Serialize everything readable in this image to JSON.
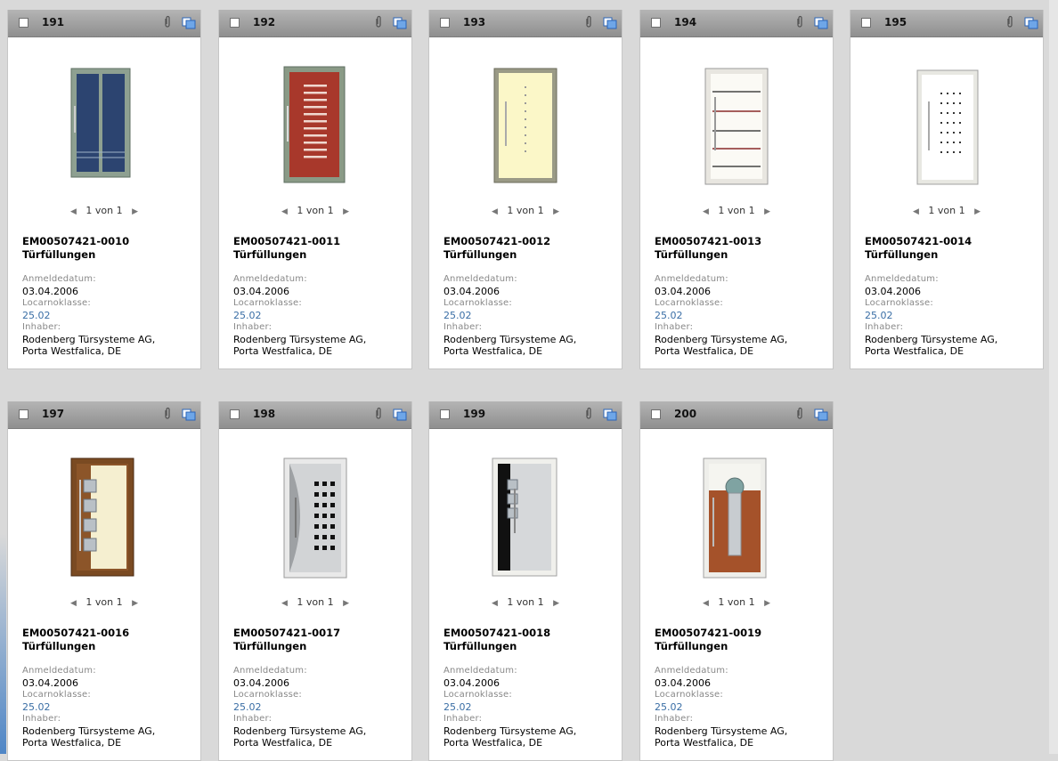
{
  "pager": {
    "prev_icon": "arrow-left-icon",
    "next_icon": "arrow-right-icon"
  },
  "labels": {
    "filing_date": "Anmeldedatum:",
    "locarno": "Locarnoklasse:",
    "owner": "Inhaber:"
  },
  "colors": {
    "header": "#9e9e9e",
    "link": "#3a6ea5",
    "background": "#d9d9d9"
  },
  "cards": [
    {
      "number": "191",
      "pager": "1 von 1",
      "id": "EM00507421-0010",
      "title": "Türfüllungen",
      "date": "03.04.2006",
      "locarno": "25.02",
      "owner1": "Rodenberg Türsysteme AG,",
      "owner2": "Porta Westfalica, DE",
      "design": "door-blue-glass"
    },
    {
      "number": "192",
      "pager": "1 von 1",
      "id": "EM00507421-0011",
      "title": "Türfüllungen",
      "date": "03.04.2006",
      "locarno": "25.02",
      "owner1": "Rodenberg Türsysteme AG,",
      "owner2": "Porta Westfalica, DE",
      "design": "door-red-bars"
    },
    {
      "number": "193",
      "pager": "1 von 1",
      "id": "EM00507421-0012",
      "title": "Türfüllungen",
      "date": "03.04.2006",
      "locarno": "25.02",
      "owner1": "Rodenberg Türsysteme AG,",
      "owner2": "Porta Westfalica, DE",
      "design": "door-cream-dots"
    },
    {
      "number": "194",
      "pager": "1 von 1",
      "id": "EM00507421-0013",
      "title": "Türfüllungen",
      "date": "03.04.2006",
      "locarno": "25.02",
      "owner1": "Rodenberg Türsysteme AG,",
      "owner2": "Porta Westfalica, DE",
      "design": "door-white-lines"
    },
    {
      "number": "195",
      "pager": "1 von 1",
      "id": "EM00507421-0014",
      "title": "Türfüllungen",
      "date": "03.04.2006",
      "locarno": "25.02",
      "owner1": "Rodenberg Türsysteme AG,",
      "owner2": "Porta Westfalica, DE",
      "design": "door-white-dotgrid"
    },
    {
      "number": "197",
      "pager": "1 von 1",
      "id": "EM00507421-0016",
      "title": "Türfüllungen",
      "date": "03.04.2006",
      "locarno": "25.02",
      "owner1": "Rodenberg Türsysteme AG,",
      "owner2": "Porta Westfalica, DE",
      "design": "door-wood-squares"
    },
    {
      "number": "198",
      "pager": "1 von 1",
      "id": "EM00507421-0017",
      "title": "Türfüllungen",
      "date": "03.04.2006",
      "locarno": "25.02",
      "owner1": "Rodenberg Türsysteme AG,",
      "owner2": "Porta Westfalica, DE",
      "design": "door-steel-holes"
    },
    {
      "number": "199",
      "pager": "1 von 1",
      "id": "EM00507421-0018",
      "title": "Türfüllungen",
      "date": "03.04.2006",
      "locarno": "25.02",
      "owner1": "Rodenberg Türsysteme AG,",
      "owner2": "Porta Westfalica, DE",
      "design": "door-steel-black"
    },
    {
      "number": "200",
      "pager": "1 von 1",
      "id": "EM00507421-0019",
      "title": "Türfüllungen",
      "date": "03.04.2006",
      "locarno": "25.02",
      "owner1": "Rodenberg Türsysteme AG,",
      "owner2": "Porta Westfalica, DE",
      "design": "door-wood-keyhole"
    }
  ]
}
